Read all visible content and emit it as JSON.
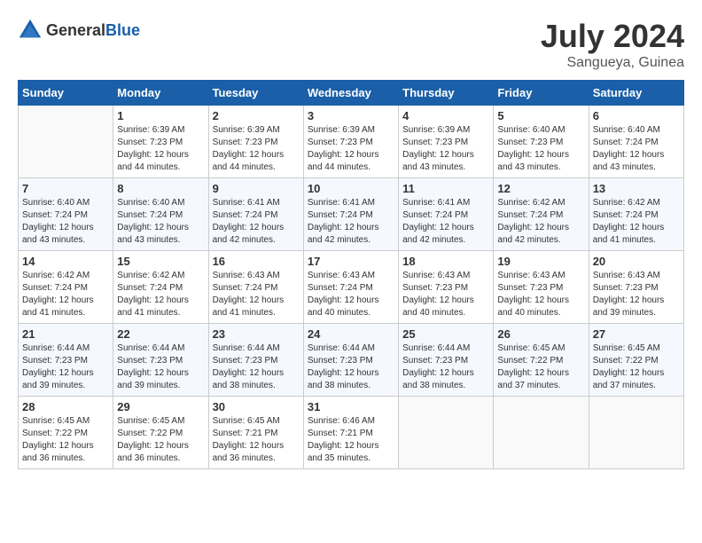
{
  "header": {
    "logo_general": "General",
    "logo_blue": "Blue",
    "month_year": "July 2024",
    "location": "Sangueya, Guinea"
  },
  "days_of_week": [
    "Sunday",
    "Monday",
    "Tuesday",
    "Wednesday",
    "Thursday",
    "Friday",
    "Saturday"
  ],
  "weeks": [
    [
      {
        "day": "",
        "sunrise": "",
        "sunset": "",
        "daylight": ""
      },
      {
        "day": "1",
        "sunrise": "Sunrise: 6:39 AM",
        "sunset": "Sunset: 7:23 PM",
        "daylight": "Daylight: 12 hours and 44 minutes."
      },
      {
        "day": "2",
        "sunrise": "Sunrise: 6:39 AM",
        "sunset": "Sunset: 7:23 PM",
        "daylight": "Daylight: 12 hours and 44 minutes."
      },
      {
        "day": "3",
        "sunrise": "Sunrise: 6:39 AM",
        "sunset": "Sunset: 7:23 PM",
        "daylight": "Daylight: 12 hours and 44 minutes."
      },
      {
        "day": "4",
        "sunrise": "Sunrise: 6:39 AM",
        "sunset": "Sunset: 7:23 PM",
        "daylight": "Daylight: 12 hours and 43 minutes."
      },
      {
        "day": "5",
        "sunrise": "Sunrise: 6:40 AM",
        "sunset": "Sunset: 7:23 PM",
        "daylight": "Daylight: 12 hours and 43 minutes."
      },
      {
        "day": "6",
        "sunrise": "Sunrise: 6:40 AM",
        "sunset": "Sunset: 7:24 PM",
        "daylight": "Daylight: 12 hours and 43 minutes."
      }
    ],
    [
      {
        "day": "7",
        "sunrise": "Sunrise: 6:40 AM",
        "sunset": "Sunset: 7:24 PM",
        "daylight": "Daylight: 12 hours and 43 minutes."
      },
      {
        "day": "8",
        "sunrise": "Sunrise: 6:40 AM",
        "sunset": "Sunset: 7:24 PM",
        "daylight": "Daylight: 12 hours and 43 minutes."
      },
      {
        "day": "9",
        "sunrise": "Sunrise: 6:41 AM",
        "sunset": "Sunset: 7:24 PM",
        "daylight": "Daylight: 12 hours and 42 minutes."
      },
      {
        "day": "10",
        "sunrise": "Sunrise: 6:41 AM",
        "sunset": "Sunset: 7:24 PM",
        "daylight": "Daylight: 12 hours and 42 minutes."
      },
      {
        "day": "11",
        "sunrise": "Sunrise: 6:41 AM",
        "sunset": "Sunset: 7:24 PM",
        "daylight": "Daylight: 12 hours and 42 minutes."
      },
      {
        "day": "12",
        "sunrise": "Sunrise: 6:42 AM",
        "sunset": "Sunset: 7:24 PM",
        "daylight": "Daylight: 12 hours and 42 minutes."
      },
      {
        "day": "13",
        "sunrise": "Sunrise: 6:42 AM",
        "sunset": "Sunset: 7:24 PM",
        "daylight": "Daylight: 12 hours and 41 minutes."
      }
    ],
    [
      {
        "day": "14",
        "sunrise": "Sunrise: 6:42 AM",
        "sunset": "Sunset: 7:24 PM",
        "daylight": "Daylight: 12 hours and 41 minutes."
      },
      {
        "day": "15",
        "sunrise": "Sunrise: 6:42 AM",
        "sunset": "Sunset: 7:24 PM",
        "daylight": "Daylight: 12 hours and 41 minutes."
      },
      {
        "day": "16",
        "sunrise": "Sunrise: 6:43 AM",
        "sunset": "Sunset: 7:24 PM",
        "daylight": "Daylight: 12 hours and 41 minutes."
      },
      {
        "day": "17",
        "sunrise": "Sunrise: 6:43 AM",
        "sunset": "Sunset: 7:24 PM",
        "daylight": "Daylight: 12 hours and 40 minutes."
      },
      {
        "day": "18",
        "sunrise": "Sunrise: 6:43 AM",
        "sunset": "Sunset: 7:23 PM",
        "daylight": "Daylight: 12 hours and 40 minutes."
      },
      {
        "day": "19",
        "sunrise": "Sunrise: 6:43 AM",
        "sunset": "Sunset: 7:23 PM",
        "daylight": "Daylight: 12 hours and 40 minutes."
      },
      {
        "day": "20",
        "sunrise": "Sunrise: 6:43 AM",
        "sunset": "Sunset: 7:23 PM",
        "daylight": "Daylight: 12 hours and 39 minutes."
      }
    ],
    [
      {
        "day": "21",
        "sunrise": "Sunrise: 6:44 AM",
        "sunset": "Sunset: 7:23 PM",
        "daylight": "Daylight: 12 hours and 39 minutes."
      },
      {
        "day": "22",
        "sunrise": "Sunrise: 6:44 AM",
        "sunset": "Sunset: 7:23 PM",
        "daylight": "Daylight: 12 hours and 39 minutes."
      },
      {
        "day": "23",
        "sunrise": "Sunrise: 6:44 AM",
        "sunset": "Sunset: 7:23 PM",
        "daylight": "Daylight: 12 hours and 38 minutes."
      },
      {
        "day": "24",
        "sunrise": "Sunrise: 6:44 AM",
        "sunset": "Sunset: 7:23 PM",
        "daylight": "Daylight: 12 hours and 38 minutes."
      },
      {
        "day": "25",
        "sunrise": "Sunrise: 6:44 AM",
        "sunset": "Sunset: 7:23 PM",
        "daylight": "Daylight: 12 hours and 38 minutes."
      },
      {
        "day": "26",
        "sunrise": "Sunrise: 6:45 AM",
        "sunset": "Sunset: 7:22 PM",
        "daylight": "Daylight: 12 hours and 37 minutes."
      },
      {
        "day": "27",
        "sunrise": "Sunrise: 6:45 AM",
        "sunset": "Sunset: 7:22 PM",
        "daylight": "Daylight: 12 hours and 37 minutes."
      }
    ],
    [
      {
        "day": "28",
        "sunrise": "Sunrise: 6:45 AM",
        "sunset": "Sunset: 7:22 PM",
        "daylight": "Daylight: 12 hours and 36 minutes."
      },
      {
        "day": "29",
        "sunrise": "Sunrise: 6:45 AM",
        "sunset": "Sunset: 7:22 PM",
        "daylight": "Daylight: 12 hours and 36 minutes."
      },
      {
        "day": "30",
        "sunrise": "Sunrise: 6:45 AM",
        "sunset": "Sunset: 7:21 PM",
        "daylight": "Daylight: 12 hours and 36 minutes."
      },
      {
        "day": "31",
        "sunrise": "Sunrise: 6:46 AM",
        "sunset": "Sunset: 7:21 PM",
        "daylight": "Daylight: 12 hours and 35 minutes."
      },
      {
        "day": "",
        "sunrise": "",
        "sunset": "",
        "daylight": ""
      },
      {
        "day": "",
        "sunrise": "",
        "sunset": "",
        "daylight": ""
      },
      {
        "day": "",
        "sunrise": "",
        "sunset": "",
        "daylight": ""
      }
    ]
  ]
}
